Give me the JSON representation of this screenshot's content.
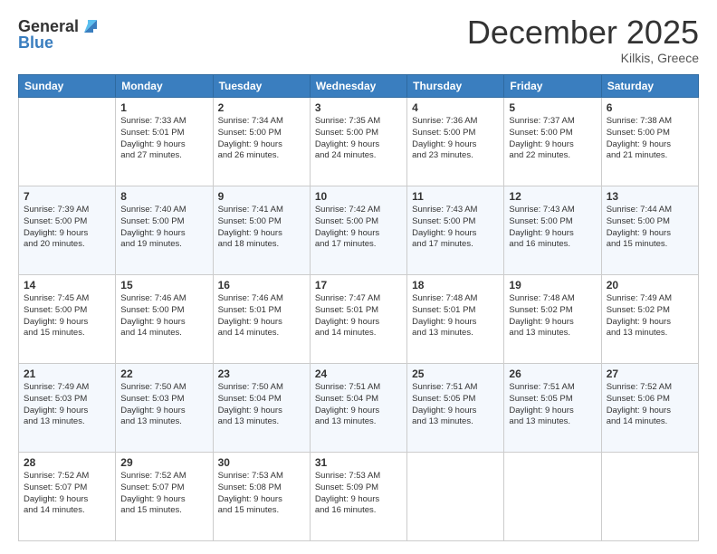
{
  "header": {
    "logo_general": "General",
    "logo_blue": "Blue",
    "month_year": "December 2025",
    "location": "Kilkis, Greece"
  },
  "columns": [
    "Sunday",
    "Monday",
    "Tuesday",
    "Wednesday",
    "Thursday",
    "Friday",
    "Saturday"
  ],
  "weeks": [
    [
      {
        "day": "",
        "info": ""
      },
      {
        "day": "1",
        "info": "Sunrise: 7:33 AM\nSunset: 5:01 PM\nDaylight: 9 hours\nand 27 minutes."
      },
      {
        "day": "2",
        "info": "Sunrise: 7:34 AM\nSunset: 5:00 PM\nDaylight: 9 hours\nand 26 minutes."
      },
      {
        "day": "3",
        "info": "Sunrise: 7:35 AM\nSunset: 5:00 PM\nDaylight: 9 hours\nand 24 minutes."
      },
      {
        "day": "4",
        "info": "Sunrise: 7:36 AM\nSunset: 5:00 PM\nDaylight: 9 hours\nand 23 minutes."
      },
      {
        "day": "5",
        "info": "Sunrise: 7:37 AM\nSunset: 5:00 PM\nDaylight: 9 hours\nand 22 minutes."
      },
      {
        "day": "6",
        "info": "Sunrise: 7:38 AM\nSunset: 5:00 PM\nDaylight: 9 hours\nand 21 minutes."
      }
    ],
    [
      {
        "day": "7",
        "info": "Sunrise: 7:39 AM\nSunset: 5:00 PM\nDaylight: 9 hours\nand 20 minutes."
      },
      {
        "day": "8",
        "info": "Sunrise: 7:40 AM\nSunset: 5:00 PM\nDaylight: 9 hours\nand 19 minutes."
      },
      {
        "day": "9",
        "info": "Sunrise: 7:41 AM\nSunset: 5:00 PM\nDaylight: 9 hours\nand 18 minutes."
      },
      {
        "day": "10",
        "info": "Sunrise: 7:42 AM\nSunset: 5:00 PM\nDaylight: 9 hours\nand 17 minutes."
      },
      {
        "day": "11",
        "info": "Sunrise: 7:43 AM\nSunset: 5:00 PM\nDaylight: 9 hours\nand 17 minutes."
      },
      {
        "day": "12",
        "info": "Sunrise: 7:43 AM\nSunset: 5:00 PM\nDaylight: 9 hours\nand 16 minutes."
      },
      {
        "day": "13",
        "info": "Sunrise: 7:44 AM\nSunset: 5:00 PM\nDaylight: 9 hours\nand 15 minutes."
      }
    ],
    [
      {
        "day": "14",
        "info": "Sunrise: 7:45 AM\nSunset: 5:00 PM\nDaylight: 9 hours\nand 15 minutes."
      },
      {
        "day": "15",
        "info": "Sunrise: 7:46 AM\nSunset: 5:00 PM\nDaylight: 9 hours\nand 14 minutes."
      },
      {
        "day": "16",
        "info": "Sunrise: 7:46 AM\nSunset: 5:01 PM\nDaylight: 9 hours\nand 14 minutes."
      },
      {
        "day": "17",
        "info": "Sunrise: 7:47 AM\nSunset: 5:01 PM\nDaylight: 9 hours\nand 14 minutes."
      },
      {
        "day": "18",
        "info": "Sunrise: 7:48 AM\nSunset: 5:01 PM\nDaylight: 9 hours\nand 13 minutes."
      },
      {
        "day": "19",
        "info": "Sunrise: 7:48 AM\nSunset: 5:02 PM\nDaylight: 9 hours\nand 13 minutes."
      },
      {
        "day": "20",
        "info": "Sunrise: 7:49 AM\nSunset: 5:02 PM\nDaylight: 9 hours\nand 13 minutes."
      }
    ],
    [
      {
        "day": "21",
        "info": "Sunrise: 7:49 AM\nSunset: 5:03 PM\nDaylight: 9 hours\nand 13 minutes."
      },
      {
        "day": "22",
        "info": "Sunrise: 7:50 AM\nSunset: 5:03 PM\nDaylight: 9 hours\nand 13 minutes."
      },
      {
        "day": "23",
        "info": "Sunrise: 7:50 AM\nSunset: 5:04 PM\nDaylight: 9 hours\nand 13 minutes."
      },
      {
        "day": "24",
        "info": "Sunrise: 7:51 AM\nSunset: 5:04 PM\nDaylight: 9 hours\nand 13 minutes."
      },
      {
        "day": "25",
        "info": "Sunrise: 7:51 AM\nSunset: 5:05 PM\nDaylight: 9 hours\nand 13 minutes."
      },
      {
        "day": "26",
        "info": "Sunrise: 7:51 AM\nSunset: 5:05 PM\nDaylight: 9 hours\nand 13 minutes."
      },
      {
        "day": "27",
        "info": "Sunrise: 7:52 AM\nSunset: 5:06 PM\nDaylight: 9 hours\nand 14 minutes."
      }
    ],
    [
      {
        "day": "28",
        "info": "Sunrise: 7:52 AM\nSunset: 5:07 PM\nDaylight: 9 hours\nand 14 minutes."
      },
      {
        "day": "29",
        "info": "Sunrise: 7:52 AM\nSunset: 5:07 PM\nDaylight: 9 hours\nand 15 minutes."
      },
      {
        "day": "30",
        "info": "Sunrise: 7:53 AM\nSunset: 5:08 PM\nDaylight: 9 hours\nand 15 minutes."
      },
      {
        "day": "31",
        "info": "Sunrise: 7:53 AM\nSunset: 5:09 PM\nDaylight: 9 hours\nand 16 minutes."
      },
      {
        "day": "",
        "info": ""
      },
      {
        "day": "",
        "info": ""
      },
      {
        "day": "",
        "info": ""
      }
    ]
  ]
}
